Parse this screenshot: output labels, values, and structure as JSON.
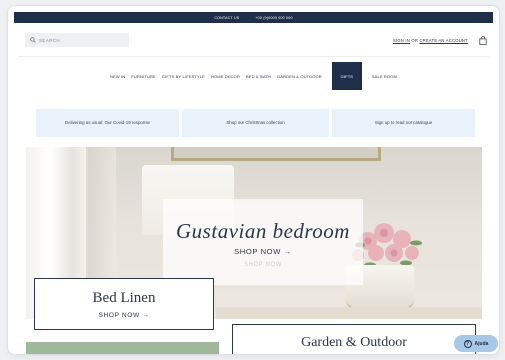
{
  "topbar": {
    "contact": "CONTACT US",
    "phone": "+00 (0)0000 000 000"
  },
  "header": {
    "search_placeholder": "SEARCH",
    "sign_in": "SIGN IN",
    "or": "OR",
    "create_account": "CREATE AN ACCOUNT"
  },
  "nav": {
    "items": [
      "NEW IN",
      "FURNITURE",
      "GIFTS BY LIFESTYLE",
      "HOME DECOR",
      "BED & BATH",
      "GARDEN & OUTDOOR",
      "GIFTS",
      "SALE ROOM"
    ]
  },
  "promos": [
    "Delivering as usual: Our Covid-19 response",
    "Shop our Christmas collection",
    "Sign up to read our catalogue"
  ],
  "hero": {
    "title": "Gustavian bedroom",
    "cta": "SHOP NOW →",
    "ghost_text": "SHOP NOW"
  },
  "cards": {
    "bed_linen": {
      "title": "Bed Linen",
      "cta": "SHOP NOW →"
    },
    "garden": {
      "title": "Garden & Outdoor"
    }
  },
  "help": {
    "label": "Ajuda"
  },
  "colors": {
    "navy": "#1f2f4a",
    "promo_bg": "#e9f1fa",
    "help_bg": "#a9c7e6"
  }
}
